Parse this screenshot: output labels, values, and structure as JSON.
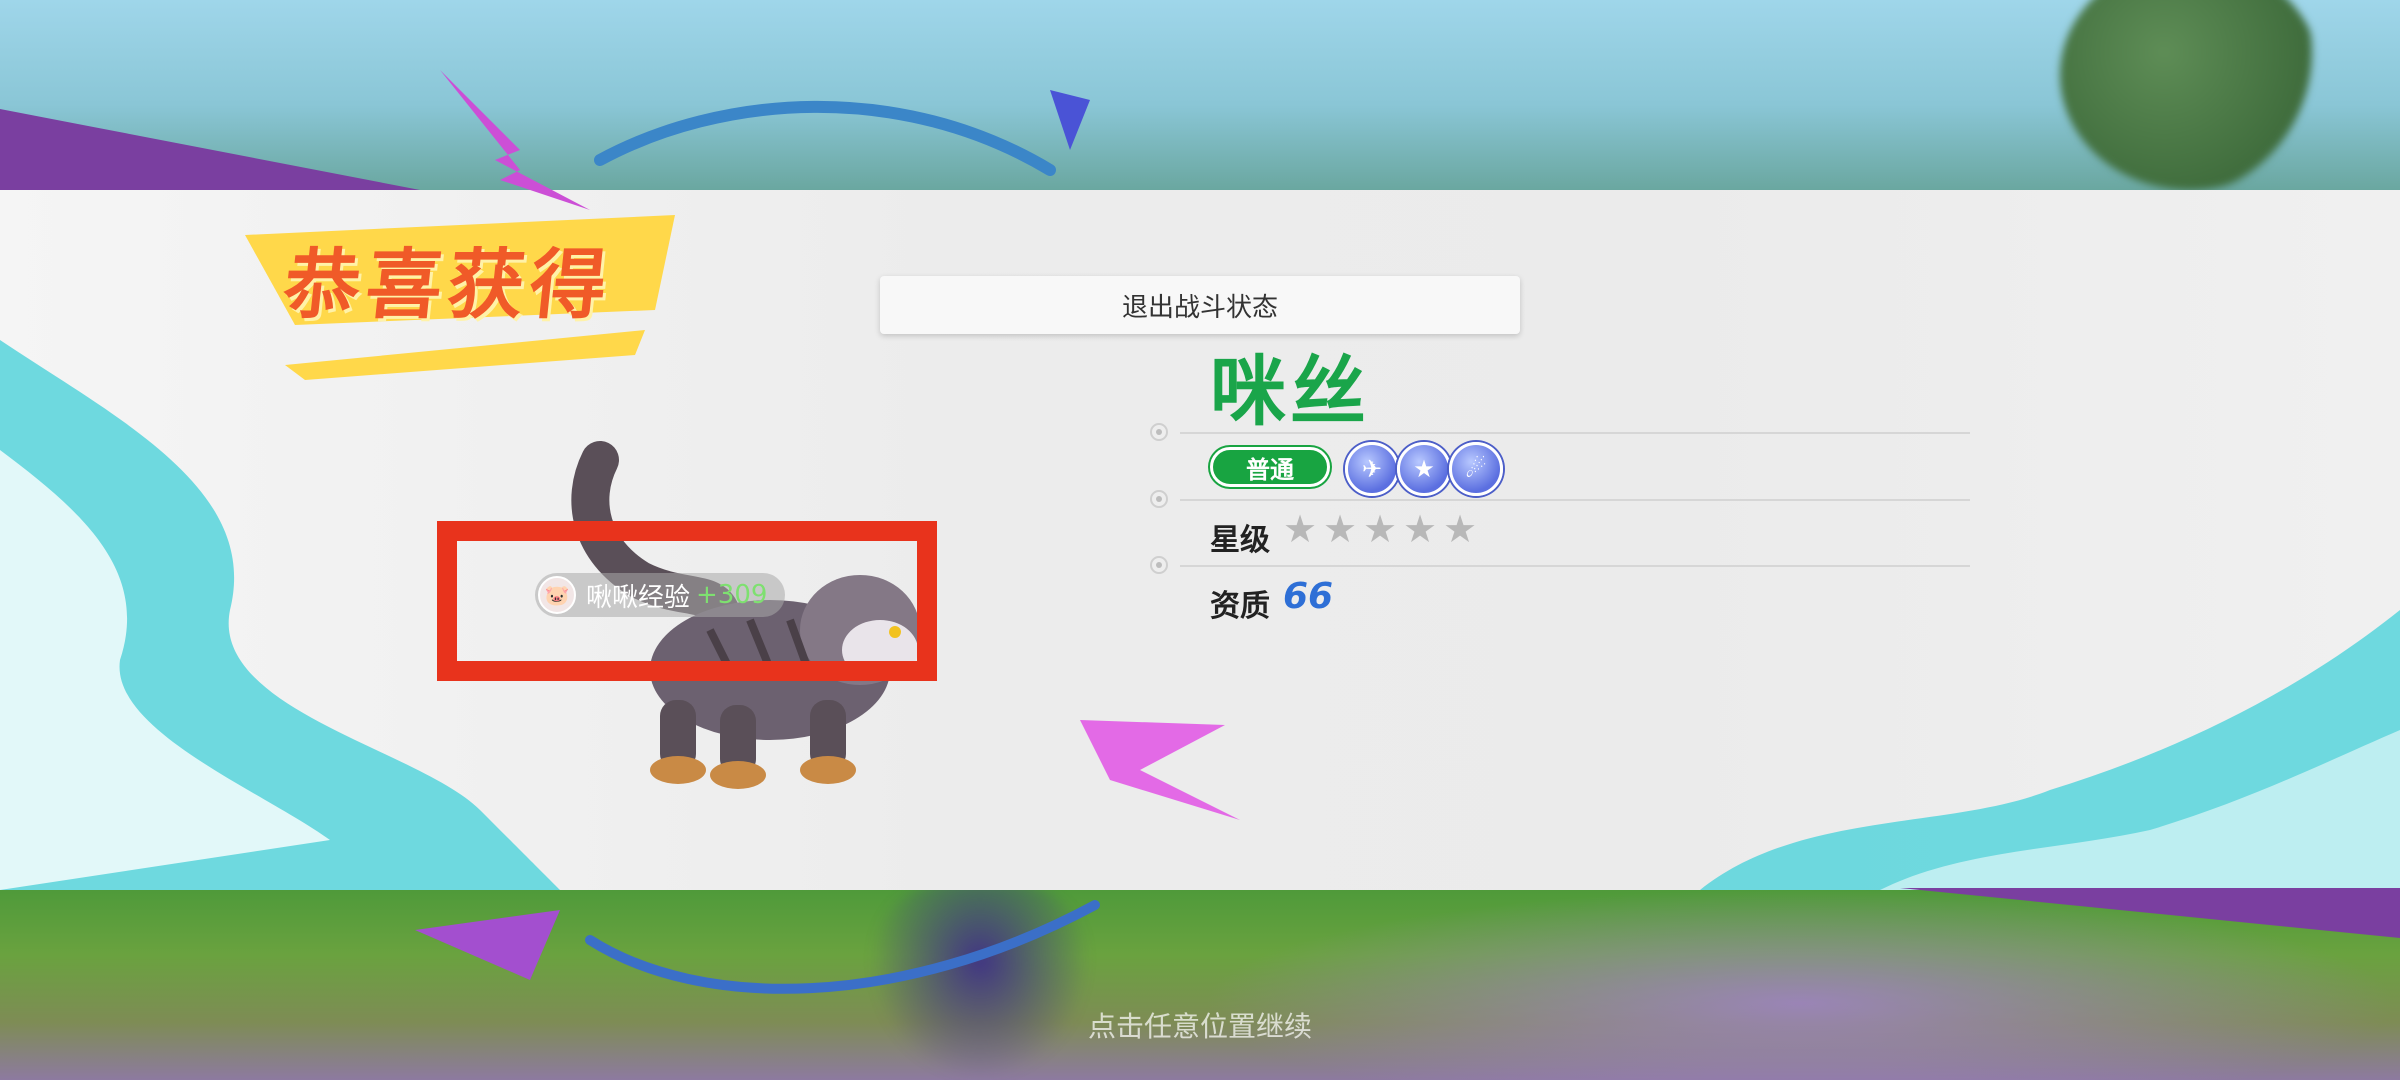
{
  "header": {
    "banner_title": "恭喜获得",
    "exit_combat_label": "退出战斗状态"
  },
  "monster": {
    "name": "咪丝",
    "type_label": "普通",
    "skill_icons": [
      "flying-kick-icon",
      "star-badge-icon",
      "comet-icon"
    ],
    "star_label": "星级",
    "stars_filled": 0,
    "stars_total": 5,
    "quality_label": "资质",
    "quality_value": "66"
  },
  "rewards": [
    {
      "icon": "pig-face-icon",
      "label": "啾啾经验",
      "amount": "+309"
    }
  ],
  "footer": {
    "continue_hint": "点击任意位置继续"
  },
  "colors": {
    "name_green": "#1aa54a",
    "banner_orange": "#f05a28",
    "highlight_red": "#e8331c",
    "quality_blue": "#2e6fd6"
  }
}
